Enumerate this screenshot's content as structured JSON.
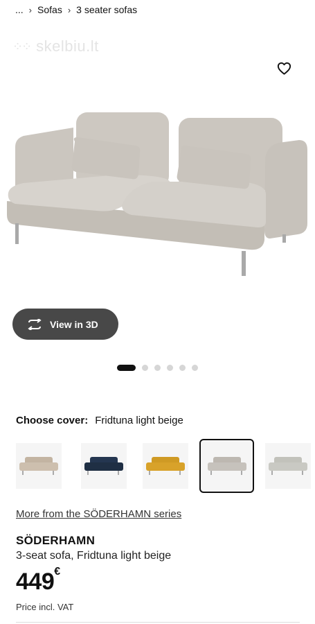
{
  "breadcrumb": {
    "ellipsis": "...",
    "items": [
      "Sofas",
      "3 seater sofas"
    ]
  },
  "watermark": "skelbiu.lt",
  "view3d": {
    "label": "View in 3D"
  },
  "carousel": {
    "total": 6,
    "active": 0
  },
  "cover": {
    "label": "Choose cover:",
    "value": "Fridtuna light beige",
    "swatches": [
      {
        "color": "#cdbfae",
        "name": "beige"
      },
      {
        "color": "#1f2f44",
        "name": "dark blue"
      },
      {
        "color": "#d8a22a",
        "name": "yellow"
      },
      {
        "color": "#c6c2bc",
        "name": "light beige",
        "selected": true
      },
      {
        "color": "#c9c9c3",
        "name": "light grey"
      }
    ]
  },
  "series_link": "More from the SÖDERHAMN series",
  "product": {
    "name": "SÖDERHAMN",
    "description": "3-seat sofa, Fridtuna light beige",
    "price": "449",
    "currency": "€",
    "price_note": "Price incl. VAT"
  },
  "colors": {
    "button_bg": "#484848",
    "sofa": "#cfcac3"
  }
}
